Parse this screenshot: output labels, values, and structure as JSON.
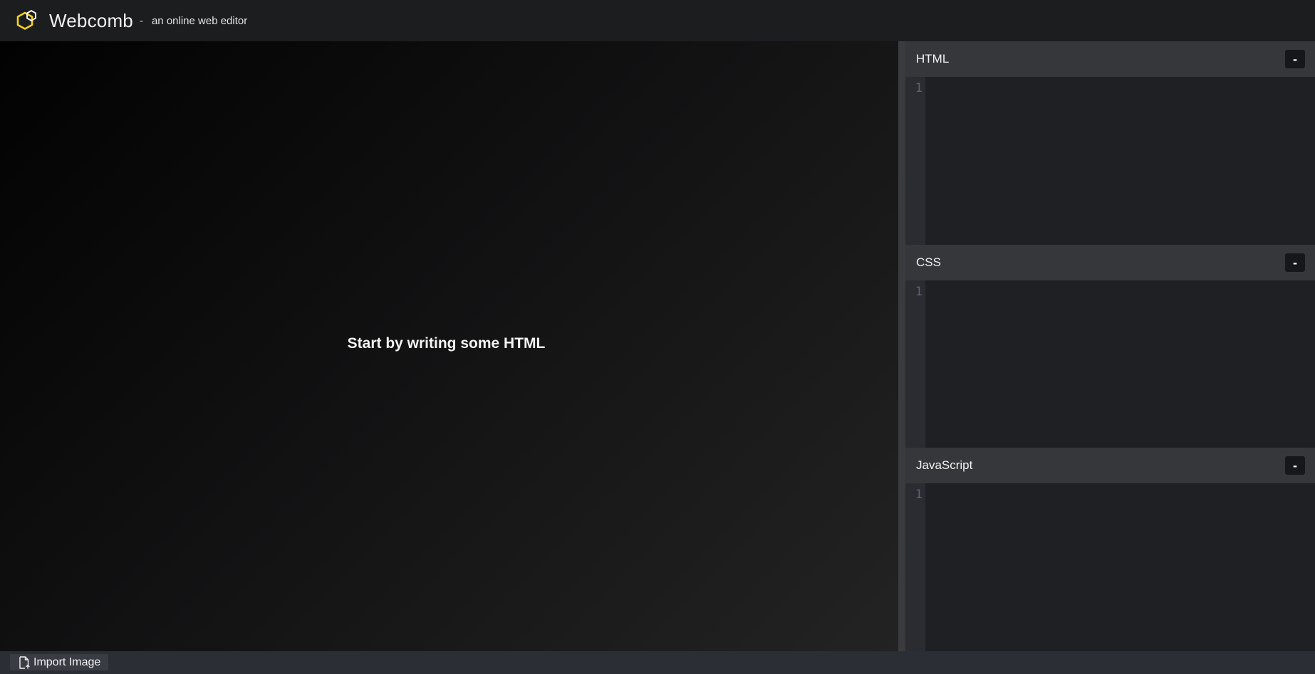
{
  "header": {
    "brand": "Webcomb",
    "separator": "-",
    "tagline": "an online web editor",
    "logo_icon": "hexagon-logo-icon",
    "accent": "#f5d21a"
  },
  "preview": {
    "placeholder": "Start by writing some HTML"
  },
  "editors": [
    {
      "title": "HTML",
      "minimize_label": "-",
      "line_number": "1",
      "content": ""
    },
    {
      "title": "CSS",
      "minimize_label": "-",
      "line_number": "1",
      "content": ""
    },
    {
      "title": "JavaScript",
      "minimize_label": "-",
      "line_number": "1",
      "content": ""
    }
  ],
  "footer": {
    "import_label": "Import Image",
    "import_icon": "file-import-icon"
  }
}
